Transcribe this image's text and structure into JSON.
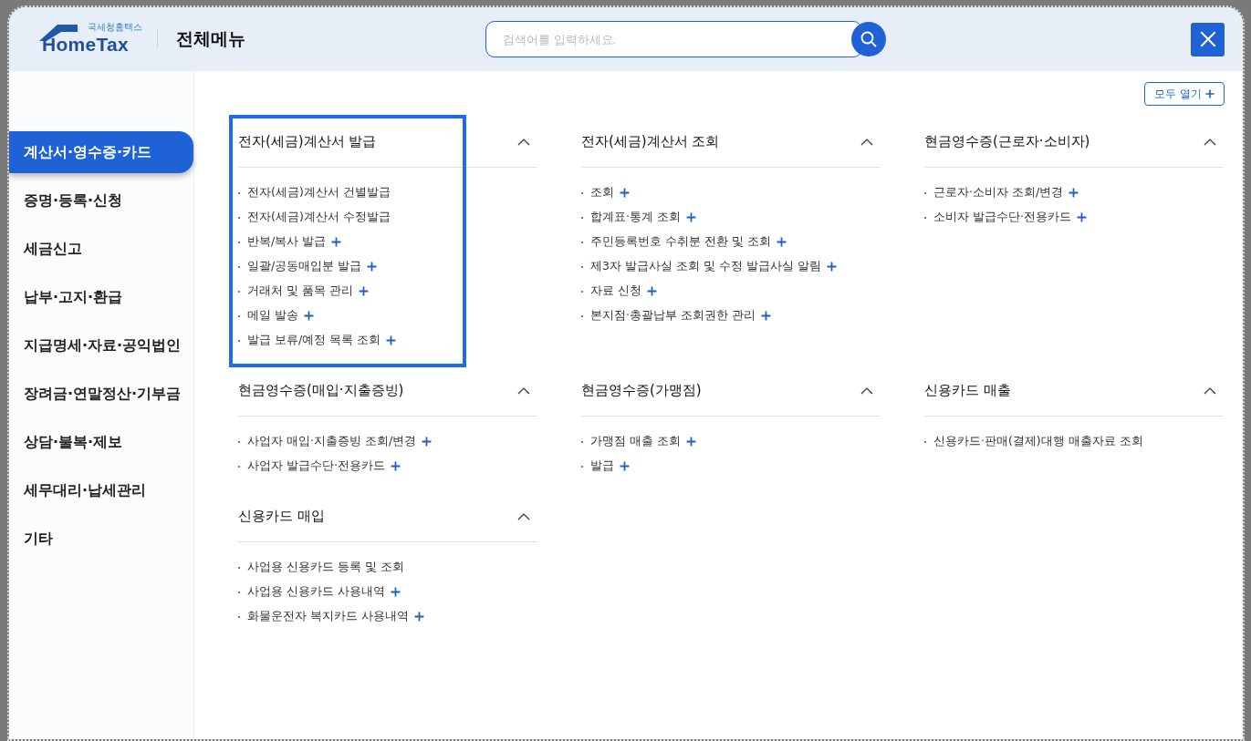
{
  "header": {
    "logo": {
      "subtitle": "국세청홈택스",
      "name": "HomeTax"
    },
    "title": "전체메뉴",
    "search": {
      "placeholder": "검색어를 입력하세요."
    }
  },
  "expand_all_button": {
    "label": "모두 열기"
  },
  "sidebar": {
    "items": [
      {
        "label": "계산서·영수증·카드",
        "selected": true
      },
      {
        "label": "증명·등록·신청",
        "selected": false
      },
      {
        "label": "세금신고",
        "selected": false
      },
      {
        "label": "납부·고지·환급",
        "selected": false
      },
      {
        "label": "지급명세·자료·공익법인",
        "selected": false
      },
      {
        "label": "장려금·연말정산·기부금",
        "selected": false
      },
      {
        "label": "상담·불복·제보",
        "selected": false
      },
      {
        "label": "세무대리·납세관리",
        "selected": false
      },
      {
        "label": "기타",
        "selected": false
      }
    ]
  },
  "rows": [
    [
      [
        {
          "title": "전자(세금)계산서 발급",
          "expanded": true,
          "highlighted": true,
          "items": [
            {
              "label": "전자(세금)계산서 건별발급",
              "has_submenu": false
            },
            {
              "label": "전자(세금)계산서 수정발급",
              "has_submenu": false
            },
            {
              "label": "반복/복사 발급",
              "has_submenu": true
            },
            {
              "label": "일괄/공동매입분 발급",
              "has_submenu": true
            },
            {
              "label": "거래처 및 품목 관리",
              "has_submenu": true
            },
            {
              "label": "메일 발송",
              "has_submenu": true
            },
            {
              "label": "발급 보류/예정 목록 조회",
              "has_submenu": true
            }
          ]
        }
      ],
      [
        {
          "title": "전자(세금)계산서 조회",
          "expanded": true,
          "highlighted": false,
          "items": [
            {
              "label": "조회",
              "has_submenu": true
            },
            {
              "label": "합계표·통계 조회",
              "has_submenu": true
            },
            {
              "label": "주민등록번호 수취분 전환 및 조회",
              "has_submenu": true
            },
            {
              "label": "제3자 발급사실 조회 및 수정 발급사실 알림",
              "has_submenu": true
            },
            {
              "label": "자료 신청",
              "has_submenu": true
            },
            {
              "label": "본지점·총괄납부 조회권한 관리",
              "has_submenu": true
            }
          ]
        }
      ],
      [
        {
          "title": "현금영수증(근로자·소비자)",
          "expanded": true,
          "highlighted": false,
          "items": [
            {
              "label": "근로자·소비자 조회/변경",
              "has_submenu": true
            },
            {
              "label": "소비자 발급수단·전용카드",
              "has_submenu": true
            }
          ]
        }
      ]
    ],
    [
      [
        {
          "title": "현금영수증(매입·지출증빙)",
          "expanded": true,
          "highlighted": false,
          "items": [
            {
              "label": "사업자 매입·지출증빙 조회/변경",
              "has_submenu": true
            },
            {
              "label": "사업자 발급수단·전용카드",
              "has_submenu": true
            }
          ]
        },
        {
          "title": "신용카드 매입",
          "expanded": true,
          "highlighted": false,
          "items": [
            {
              "label": "사업용 신용카드 등록 및 조회",
              "has_submenu": false
            },
            {
              "label": "사업용 신용카드 사용내역",
              "has_submenu": true
            },
            {
              "label": "화물운전자 복지카드 사용내역",
              "has_submenu": true
            }
          ]
        }
      ],
      [
        {
          "title": "현금영수증(가맹점)",
          "expanded": true,
          "highlighted": false,
          "items": [
            {
              "label": "가맹점 매출 조회",
              "has_submenu": true
            },
            {
              "label": "발급",
              "has_submenu": true
            }
          ]
        }
      ],
      [
        {
          "title": "신용카드 매출",
          "expanded": true,
          "highlighted": false,
          "items": [
            {
              "label": "신용카드·판매(결제)대행 매출자료 조회",
              "has_submenu": false
            }
          ]
        }
      ]
    ]
  ]
}
